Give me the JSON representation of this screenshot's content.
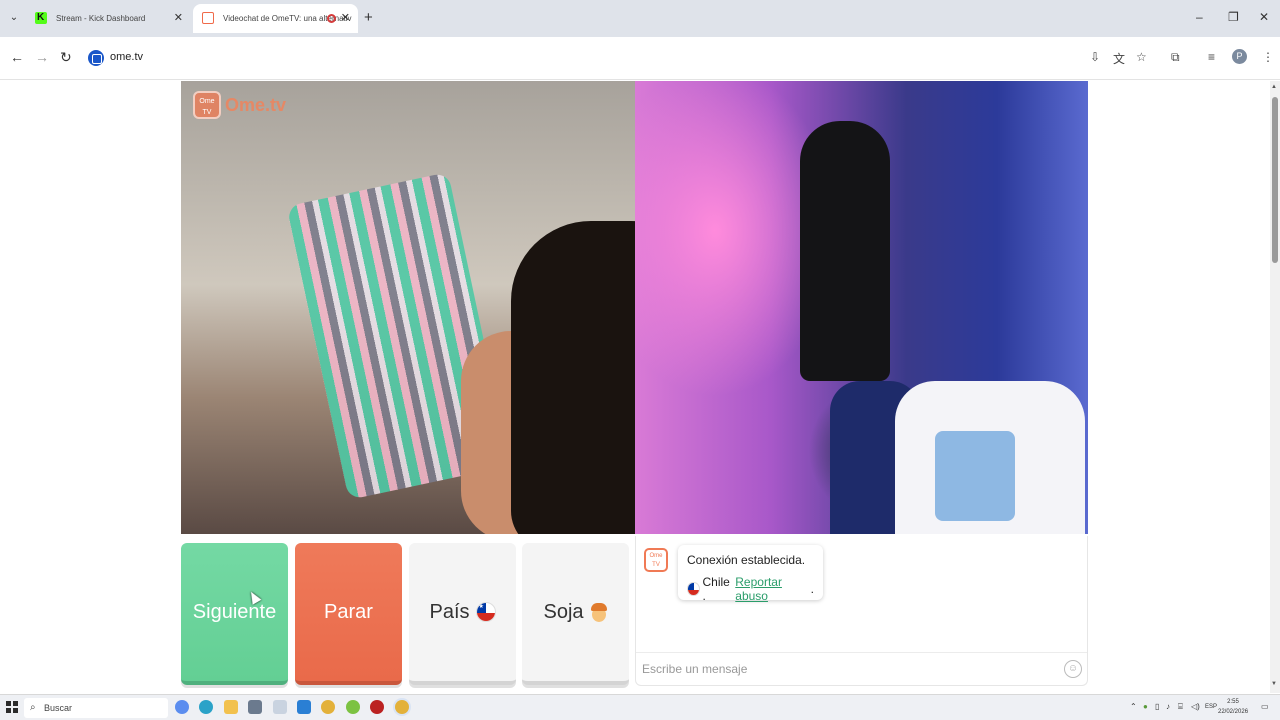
{
  "browser": {
    "tabs": [
      {
        "title": "Stream - Kick Dashboard"
      },
      {
        "title": "Videochat de OmeTV: una alternativ"
      }
    ],
    "url": "ome.tv",
    "profile_initial": "P"
  },
  "video": {
    "watermark": "Ome.tv",
    "watermark_badge": "Ome TV"
  },
  "controls": {
    "next_label": "Siguiente",
    "stop_label": "Parar",
    "country_label": "País",
    "gender_label": "Soja"
  },
  "chat": {
    "logo": "Ome TV",
    "status": "Conexión establecida.",
    "country": "Chile .",
    "report_link": "Reportar abuso",
    "report_suffix": ".",
    "input_placeholder": "Escribe un mensaje"
  },
  "taskbar": {
    "search_label": "Buscar",
    "tray_lang": "ESP",
    "time": "2:55",
    "date": "22/02/2026"
  },
  "colors": {
    "next_green": "#63cf94",
    "stop_orange": "#e96a4a",
    "link_green": "#2a9d6a",
    "brand_orange": "#f07a55"
  },
  "icons": [
    "search-icon",
    "close-icon",
    "plus-icon",
    "back-icon",
    "forward-icon",
    "reload-icon",
    "install-icon",
    "translate-icon",
    "star-icon",
    "extensions-icon",
    "media-icon",
    "menu-icon",
    "chile-flag-icon",
    "boy-emoji-icon",
    "emoji-icon",
    "windows-start-icon"
  ]
}
